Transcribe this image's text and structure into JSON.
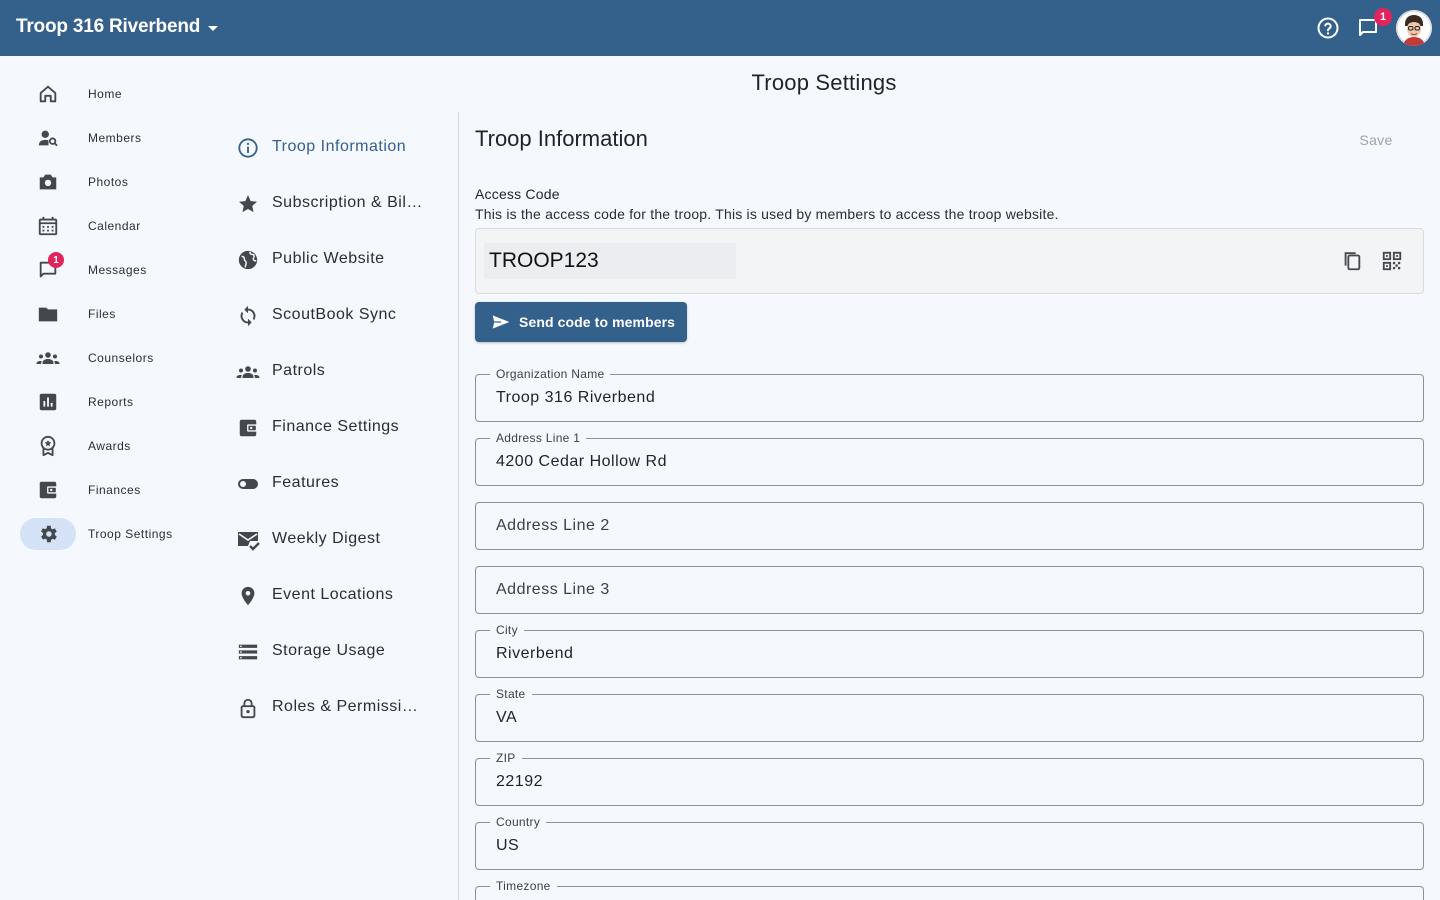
{
  "header": {
    "org_name": "Troop 316 Riverbend",
    "message_badge": "1"
  },
  "nav": {
    "items": [
      {
        "label": "Home",
        "icon": "home-icon"
      },
      {
        "label": "Members",
        "icon": "person-search-icon"
      },
      {
        "label": "Photos",
        "icon": "camera-icon"
      },
      {
        "label": "Calendar",
        "icon": "calendar-icon"
      },
      {
        "label": "Messages",
        "icon": "chat-icon",
        "badge": "1"
      },
      {
        "label": "Files",
        "icon": "folder-icon"
      },
      {
        "label": "Counselors",
        "icon": "groups-icon"
      },
      {
        "label": "Reports",
        "icon": "bar-chart-icon"
      },
      {
        "label": "Awards",
        "icon": "award-icon"
      },
      {
        "label": "Finances",
        "icon": "wallet-icon"
      },
      {
        "label": "Troop Settings",
        "icon": "gear-icon",
        "active": true
      }
    ]
  },
  "page": {
    "title": "Troop Settings"
  },
  "settings_nav": {
    "items": [
      {
        "label": "Troop Information",
        "icon": "info-icon",
        "active": true
      },
      {
        "label": "Subscription & Billing",
        "icon": "star-icon"
      },
      {
        "label": "Public Website",
        "icon": "globe-icon"
      },
      {
        "label": "ScoutBook Sync",
        "icon": "sync-icon"
      },
      {
        "label": "Patrols",
        "icon": "groups-icon"
      },
      {
        "label": "Finance Settings",
        "icon": "wallet-icon"
      },
      {
        "label": "Features",
        "icon": "toggle-icon"
      },
      {
        "label": "Weekly Digest",
        "icon": "mark-email-read-icon"
      },
      {
        "label": "Event Locations",
        "icon": "location-pin-icon"
      },
      {
        "label": "Storage Usage",
        "icon": "storage-icon"
      },
      {
        "label": "Roles & Permissions",
        "icon": "lock-icon"
      }
    ]
  },
  "troop_info": {
    "title": "Troop Information",
    "save_label": "Save",
    "access_code_label": "Access Code",
    "access_code_description": "This is the access code for the troop. This is used by members to access the troop website.",
    "access_code_value": "TROOP123",
    "send_code_label": "Send code to members",
    "fields": [
      {
        "label": "Organization Name",
        "value": "Troop 316 Riverbend",
        "placeholder": ""
      },
      {
        "label": "Address Line 1",
        "value": "4200 Cedar Hollow Rd",
        "placeholder": ""
      },
      {
        "label": "",
        "value": "",
        "placeholder": "Address Line 2"
      },
      {
        "label": "",
        "value": "",
        "placeholder": "Address Line 3"
      },
      {
        "label": "City",
        "value": "Riverbend",
        "placeholder": ""
      },
      {
        "label": "State",
        "value": "VA",
        "placeholder": ""
      },
      {
        "label": "ZIP",
        "value": "22192",
        "placeholder": ""
      },
      {
        "label": "Country",
        "value": "US",
        "placeholder": ""
      },
      {
        "label": "Timezone",
        "value": "",
        "placeholder": ""
      }
    ]
  },
  "colors": {
    "primary": "#34608c",
    "background": "#f5f8fd",
    "badge": "#e0245e",
    "active_pill": "#d3e2f4"
  }
}
